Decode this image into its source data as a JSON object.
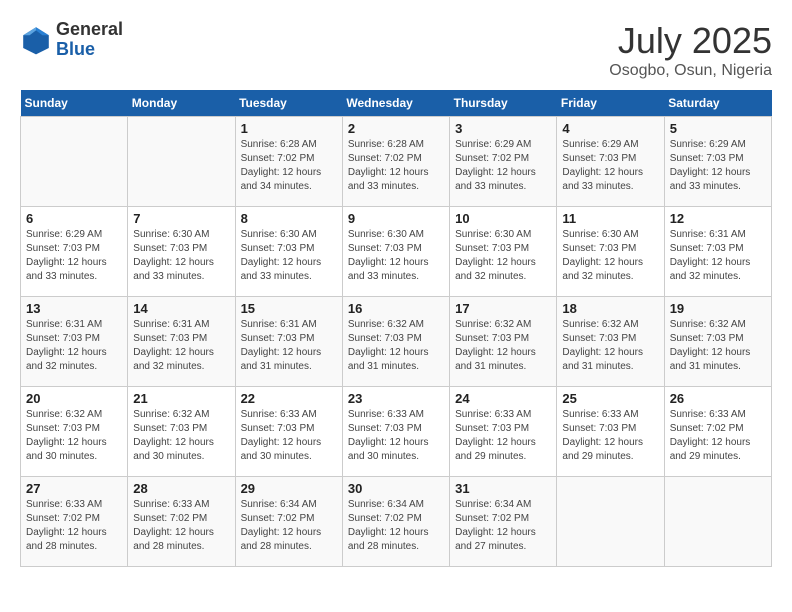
{
  "header": {
    "logo_general": "General",
    "logo_blue": "Blue",
    "month_year": "July 2025",
    "location": "Osogbo, Osun, Nigeria"
  },
  "days_of_week": [
    "Sunday",
    "Monday",
    "Tuesday",
    "Wednesday",
    "Thursday",
    "Friday",
    "Saturday"
  ],
  "weeks": [
    [
      {
        "day": "",
        "info": ""
      },
      {
        "day": "",
        "info": ""
      },
      {
        "day": "1",
        "info": "Sunrise: 6:28 AM\nSunset: 7:02 PM\nDaylight: 12 hours and 34 minutes."
      },
      {
        "day": "2",
        "info": "Sunrise: 6:28 AM\nSunset: 7:02 PM\nDaylight: 12 hours and 33 minutes."
      },
      {
        "day": "3",
        "info": "Sunrise: 6:29 AM\nSunset: 7:02 PM\nDaylight: 12 hours and 33 minutes."
      },
      {
        "day": "4",
        "info": "Sunrise: 6:29 AM\nSunset: 7:03 PM\nDaylight: 12 hours and 33 minutes."
      },
      {
        "day": "5",
        "info": "Sunrise: 6:29 AM\nSunset: 7:03 PM\nDaylight: 12 hours and 33 minutes."
      }
    ],
    [
      {
        "day": "6",
        "info": "Sunrise: 6:29 AM\nSunset: 7:03 PM\nDaylight: 12 hours and 33 minutes."
      },
      {
        "day": "7",
        "info": "Sunrise: 6:30 AM\nSunset: 7:03 PM\nDaylight: 12 hours and 33 minutes."
      },
      {
        "day": "8",
        "info": "Sunrise: 6:30 AM\nSunset: 7:03 PM\nDaylight: 12 hours and 33 minutes."
      },
      {
        "day": "9",
        "info": "Sunrise: 6:30 AM\nSunset: 7:03 PM\nDaylight: 12 hours and 33 minutes."
      },
      {
        "day": "10",
        "info": "Sunrise: 6:30 AM\nSunset: 7:03 PM\nDaylight: 12 hours and 32 minutes."
      },
      {
        "day": "11",
        "info": "Sunrise: 6:30 AM\nSunset: 7:03 PM\nDaylight: 12 hours and 32 minutes."
      },
      {
        "day": "12",
        "info": "Sunrise: 6:31 AM\nSunset: 7:03 PM\nDaylight: 12 hours and 32 minutes."
      }
    ],
    [
      {
        "day": "13",
        "info": "Sunrise: 6:31 AM\nSunset: 7:03 PM\nDaylight: 12 hours and 32 minutes."
      },
      {
        "day": "14",
        "info": "Sunrise: 6:31 AM\nSunset: 7:03 PM\nDaylight: 12 hours and 32 minutes."
      },
      {
        "day": "15",
        "info": "Sunrise: 6:31 AM\nSunset: 7:03 PM\nDaylight: 12 hours and 31 minutes."
      },
      {
        "day": "16",
        "info": "Sunrise: 6:32 AM\nSunset: 7:03 PM\nDaylight: 12 hours and 31 minutes."
      },
      {
        "day": "17",
        "info": "Sunrise: 6:32 AM\nSunset: 7:03 PM\nDaylight: 12 hours and 31 minutes."
      },
      {
        "day": "18",
        "info": "Sunrise: 6:32 AM\nSunset: 7:03 PM\nDaylight: 12 hours and 31 minutes."
      },
      {
        "day": "19",
        "info": "Sunrise: 6:32 AM\nSunset: 7:03 PM\nDaylight: 12 hours and 31 minutes."
      }
    ],
    [
      {
        "day": "20",
        "info": "Sunrise: 6:32 AM\nSunset: 7:03 PM\nDaylight: 12 hours and 30 minutes."
      },
      {
        "day": "21",
        "info": "Sunrise: 6:32 AM\nSunset: 7:03 PM\nDaylight: 12 hours and 30 minutes."
      },
      {
        "day": "22",
        "info": "Sunrise: 6:33 AM\nSunset: 7:03 PM\nDaylight: 12 hours and 30 minutes."
      },
      {
        "day": "23",
        "info": "Sunrise: 6:33 AM\nSunset: 7:03 PM\nDaylight: 12 hours and 30 minutes."
      },
      {
        "day": "24",
        "info": "Sunrise: 6:33 AM\nSunset: 7:03 PM\nDaylight: 12 hours and 29 minutes."
      },
      {
        "day": "25",
        "info": "Sunrise: 6:33 AM\nSunset: 7:03 PM\nDaylight: 12 hours and 29 minutes."
      },
      {
        "day": "26",
        "info": "Sunrise: 6:33 AM\nSunset: 7:02 PM\nDaylight: 12 hours and 29 minutes."
      }
    ],
    [
      {
        "day": "27",
        "info": "Sunrise: 6:33 AM\nSunset: 7:02 PM\nDaylight: 12 hours and 28 minutes."
      },
      {
        "day": "28",
        "info": "Sunrise: 6:33 AM\nSunset: 7:02 PM\nDaylight: 12 hours and 28 minutes."
      },
      {
        "day": "29",
        "info": "Sunrise: 6:34 AM\nSunset: 7:02 PM\nDaylight: 12 hours and 28 minutes."
      },
      {
        "day": "30",
        "info": "Sunrise: 6:34 AM\nSunset: 7:02 PM\nDaylight: 12 hours and 28 minutes."
      },
      {
        "day": "31",
        "info": "Sunrise: 6:34 AM\nSunset: 7:02 PM\nDaylight: 12 hours and 27 minutes."
      },
      {
        "day": "",
        "info": ""
      },
      {
        "day": "",
        "info": ""
      }
    ]
  ]
}
